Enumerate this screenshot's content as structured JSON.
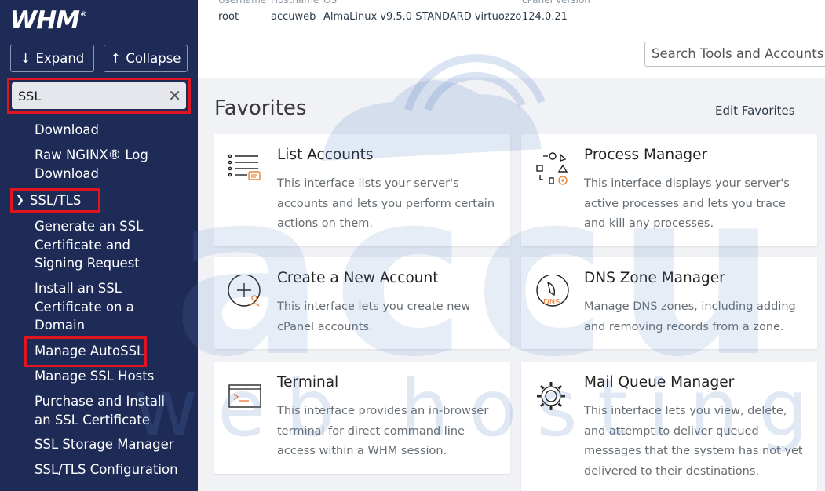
{
  "logo": "WHM",
  "sidebar": {
    "expand_label": "Expand",
    "collapse_label": "Collapse",
    "search_value": "SSL",
    "items_top": [
      "Download",
      "Raw NGINX® Log Download"
    ],
    "category": "SSL/TLS",
    "items": [
      "Generate an SSL Certificate and Signing Request",
      "Install an SSL Certificate on a Domain",
      "Manage AutoSSL",
      "Manage SSL Hosts",
      "Purchase and Install an SSL Certificate",
      "SSL Storage Manager",
      "SSL/TLS Configuration"
    ]
  },
  "header": {
    "username_label": "Username",
    "username": "root",
    "hostname_label": "Hostname",
    "hostname": "accuweb",
    "os_label": "OS",
    "os": "AlmaLinux v9.5.0 STANDARD virtuozzo",
    "cpanel_label": "cPanel Version",
    "cpanel": "124.0.21",
    "search_placeholder": "Search Tools and Accounts (/"
  },
  "main": {
    "title": "Favorites",
    "edit_label": "Edit Favorites",
    "cards": [
      {
        "title": "List Accounts",
        "desc": "This interface lists your server's accounts and lets you perform certain actions on them."
      },
      {
        "title": "Process Manager",
        "desc": "This interface displays your server's active processes and lets you trace and kill any processes."
      },
      {
        "title": "Create a New Account",
        "desc": "This interface lets you create new cPanel accounts."
      },
      {
        "title": "DNS Zone Manager",
        "desc": "Manage DNS zones, including adding and removing records from a zone."
      },
      {
        "title": "Terminal",
        "desc": "This interface provides an in-browser terminal for direct command line access within a WHM session."
      },
      {
        "title": "Mail Queue Manager",
        "desc": "This interface lets you view, delete, and attempt to deliver queued messages that the system has not yet delivered to their destinations."
      }
    ]
  },
  "watermark": {
    "word1": "accu",
    "word2": "web hosting"
  },
  "colors": {
    "sidebar": "#1f2b57",
    "highlight": "#e0151f",
    "icon_accent": "#e8833a"
  }
}
